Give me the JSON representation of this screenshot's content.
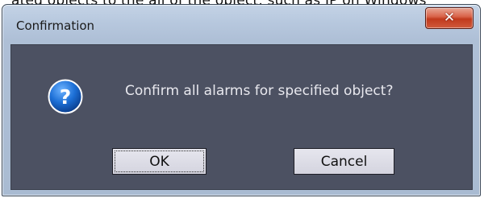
{
  "background": {
    "partial_text": "ated objects to the all of the object, such as IP on Windows"
  },
  "dialog": {
    "title": "Confirmation",
    "close_glyph": "✕",
    "message": "Confirm all alarms for specified object?",
    "icon": "question-icon",
    "ok_label": "OK",
    "cancel_label": "Cancel",
    "colors": {
      "client_bg": "#4c5162",
      "titlebar_bg": "#b7c8de",
      "close_red": "#c13a1d",
      "icon_blue": "#1c6fd6"
    }
  }
}
